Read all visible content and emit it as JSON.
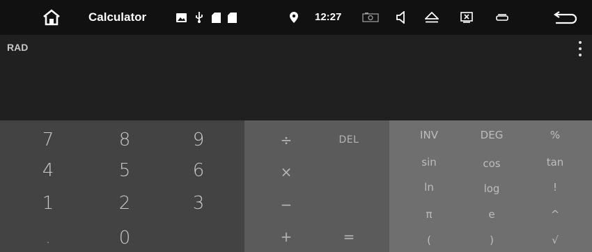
{
  "status_bar": {
    "app_title": "Calculator",
    "time": "12:27",
    "icons": [
      "home-icon",
      "image-icon",
      "usb-icon",
      "sd-card-icon",
      "sd-card-icon",
      "location-pin-icon",
      "screenshot-icon",
      "volume-icon",
      "eject-icon",
      "close-window-icon",
      "recent-apps-icon",
      "back-icon"
    ]
  },
  "display": {
    "mode": "RAD",
    "expression": "",
    "result": ""
  },
  "keypad": {
    "numbers": [
      "7",
      "8",
      "9",
      "4",
      "5",
      "6",
      "1",
      "2",
      "3",
      ".",
      "0"
    ],
    "operators": {
      "divide": "÷",
      "delete": "DEL",
      "multiply": "×",
      "minus": "−",
      "plus": "+",
      "equals": "="
    },
    "advanced": [
      "INV",
      "DEG",
      "%",
      "sin",
      "cos",
      "tan",
      "ln",
      "log",
      "!",
      "π",
      "e",
      "^",
      "(",
      ")",
      "√"
    ]
  },
  "colors": {
    "status_bar": "#111111",
    "display": "#202020",
    "num_pad": "#434343",
    "op_pad": "#5b5b5b",
    "adv_pad": "#6f6f6f"
  }
}
